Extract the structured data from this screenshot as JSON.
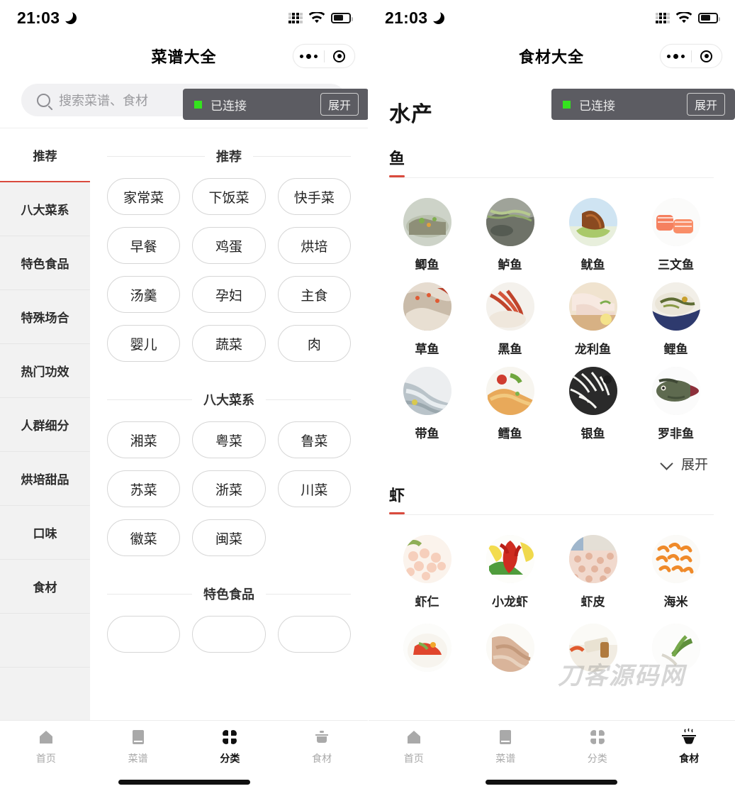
{
  "status_bar": {
    "time": "21:03",
    "dnd_icon": "crescent-moon-icon",
    "signal_icon": "signal-dots-icon",
    "wifi_icon": "wifi-icon",
    "battery_icon": "battery-icon",
    "battery_level": 55
  },
  "colors": {
    "accent_red": "#d94a3d",
    "toast_bg": "#5c5c62",
    "toast_dot_green": "#34e31e",
    "sidebar_bg": "#f2f2f2",
    "search_bg": "#f1f1f3",
    "active_text": "#111111",
    "inactive_text": "#a9a9a9"
  },
  "toast": {
    "label": "已连接",
    "button": "展开",
    "dot": "status-dot-green"
  },
  "left": {
    "nav_title": "菜谱大全",
    "capsule": {
      "more_icon": "more-dots-icon",
      "target_icon": "target-circle-icon"
    },
    "search": {
      "placeholder": "搜索菜谱、食材",
      "icon": "search-icon",
      "value": ""
    },
    "sidebar": [
      {
        "label": "推荐",
        "active": true
      },
      {
        "label": "八大菜系",
        "active": false
      },
      {
        "label": "特色食品",
        "active": false
      },
      {
        "label": "特殊场合",
        "active": false
      },
      {
        "label": "热门功效",
        "active": false
      },
      {
        "label": "人群细分",
        "active": false
      },
      {
        "label": "烘培甜品",
        "active": false
      },
      {
        "label": "口味",
        "active": false
      },
      {
        "label": "食材",
        "active": false
      }
    ],
    "sections": [
      {
        "title": "推荐",
        "chips": [
          "家常菜",
          "下饭菜",
          "快手菜",
          "早餐",
          "鸡蛋",
          "烘培",
          "汤羹",
          "孕妇",
          "主食",
          "婴儿",
          "蔬菜",
          "肉"
        ]
      },
      {
        "title": "八大菜系",
        "chips": [
          "湘菜",
          "粤菜",
          "鲁菜",
          "苏菜",
          "浙菜",
          "川菜",
          "徽菜",
          "闽菜"
        ]
      },
      {
        "title": "特色食品",
        "chips": [
          "",
          "",
          ""
        ]
      }
    ],
    "tabbar": [
      {
        "label": "首页",
        "icon": "home-icon",
        "active": false
      },
      {
        "label": "菜谱",
        "icon": "book-icon",
        "active": false
      },
      {
        "label": "分类",
        "icon": "grid-clover-icon",
        "active": true
      },
      {
        "label": "食材",
        "icon": "pot-icon",
        "active": false
      }
    ]
  },
  "right": {
    "nav_title": "食材大全",
    "capsule": {
      "more_icon": "more-dots-icon",
      "target_icon": "target-circle-icon"
    },
    "page_title": "水产",
    "groups": [
      {
        "name": "鱼",
        "items": [
          {
            "label": "鲫鱼",
            "img": "crucian-carp-thumb"
          },
          {
            "label": "鲈鱼",
            "img": "perch-thumb"
          },
          {
            "label": "鱿鱼",
            "img": "squid-thumb"
          },
          {
            "label": "三文鱼",
            "img": "salmon-thumb"
          },
          {
            "label": "草鱼",
            "img": "grass-carp-thumb"
          },
          {
            "label": "黑鱼",
            "img": "snakehead-thumb"
          },
          {
            "label": "龙利鱼",
            "img": "sole-fish-thumb"
          },
          {
            "label": "鲤鱼",
            "img": "carp-thumb"
          },
          {
            "label": "带鱼",
            "img": "ribbonfish-thumb"
          },
          {
            "label": "鳕鱼",
            "img": "cod-thumb"
          },
          {
            "label": "银鱼",
            "img": "whitebait-thumb"
          },
          {
            "label": "罗非鱼",
            "img": "tilapia-thumb"
          }
        ],
        "expand": {
          "label": "展开",
          "icon": "chevron-down-icon"
        }
      },
      {
        "name": "虾",
        "items": [
          {
            "label": "虾仁",
            "img": "shrimp-meat-thumb"
          },
          {
            "label": "小龙虾",
            "img": "crayfish-thumb"
          },
          {
            "label": "虾皮",
            "img": "dried-shrimp-thumb"
          },
          {
            "label": "海米",
            "img": "sea-shrimp-thumb"
          }
        ],
        "partial_row": [
          "spicy-dish-thumb",
          "prawn-thumb",
          "cut-board-thumb",
          "green-leaf-thumb"
        ]
      }
    ],
    "watermark": "刀客源码网",
    "tabbar": [
      {
        "label": "首页",
        "icon": "home-icon",
        "active": false
      },
      {
        "label": "菜谱",
        "icon": "book-icon",
        "active": false
      },
      {
        "label": "分类",
        "icon": "grid-clover-icon",
        "active": false
      },
      {
        "label": "食材",
        "icon": "bowl-steam-icon",
        "active": true
      }
    ]
  }
}
